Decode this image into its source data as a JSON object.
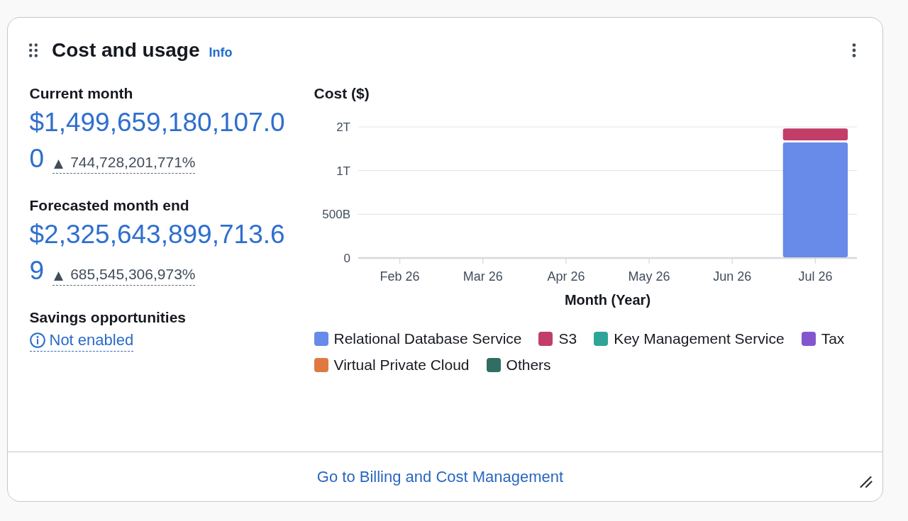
{
  "widget": {
    "title": "Cost and usage",
    "info_link": "Info"
  },
  "metrics": [
    {
      "label": "Current month",
      "value": "$1,499,659,180,107.00",
      "trend_symbol": "▲",
      "change": "744,728,201,771%"
    },
    {
      "label": "Forecasted month end",
      "value": "$2,325,643,899,713.69",
      "trend_symbol": "▲",
      "change": "685,545,306,973%"
    }
  ],
  "savings": {
    "label": "Savings opportunities",
    "status": "Not enabled"
  },
  "chart": {
    "chart_data": {
      "type": "bar",
      "stacked": true,
      "ylabel": "Cost ($)",
      "xlabel": "Month (Year)",
      "legend": "bottom",
      "categories": [
        "Feb 26",
        "Mar 26",
        "Apr 26",
        "May 26",
        "Jun 26",
        "Jul 26"
      ],
      "ylim": [
        0,
        1500000000000
      ],
      "yticks": [
        0,
        {
          "value": 500000000000,
          "label": "500B"
        },
        {
          "value": 1000000000000,
          "label": "1T"
        },
        {
          "value": 1500000000000,
          "label": "2T"
        }
      ],
      "series": [
        {
          "name": "Relational Database Service",
          "color": "#688ae8",
          "values": [
            0,
            0,
            0,
            0,
            0,
            1330000000000
          ]
        },
        {
          "name": "S3",
          "color": "#c33d69",
          "values": [
            0,
            0,
            0,
            0,
            0,
            160000000000
          ]
        },
        {
          "name": "Key Management Service",
          "color": "#2ea597",
          "values": [
            0,
            0,
            0,
            0,
            0,
            0
          ]
        },
        {
          "name": "Tax",
          "color": "#8456ce",
          "values": [
            0,
            0,
            0,
            0,
            0,
            0
          ]
        },
        {
          "name": "Virtual Private Cloud",
          "color": "#e07941",
          "values": [
            0,
            0,
            0,
            0,
            0,
            0
          ]
        },
        {
          "name": "Others",
          "color": "#306e63",
          "values": [
            0,
            0,
            0,
            0,
            0,
            0
          ]
        }
      ]
    }
  },
  "footer": {
    "link": "Go to Billing and Cost Management"
  }
}
